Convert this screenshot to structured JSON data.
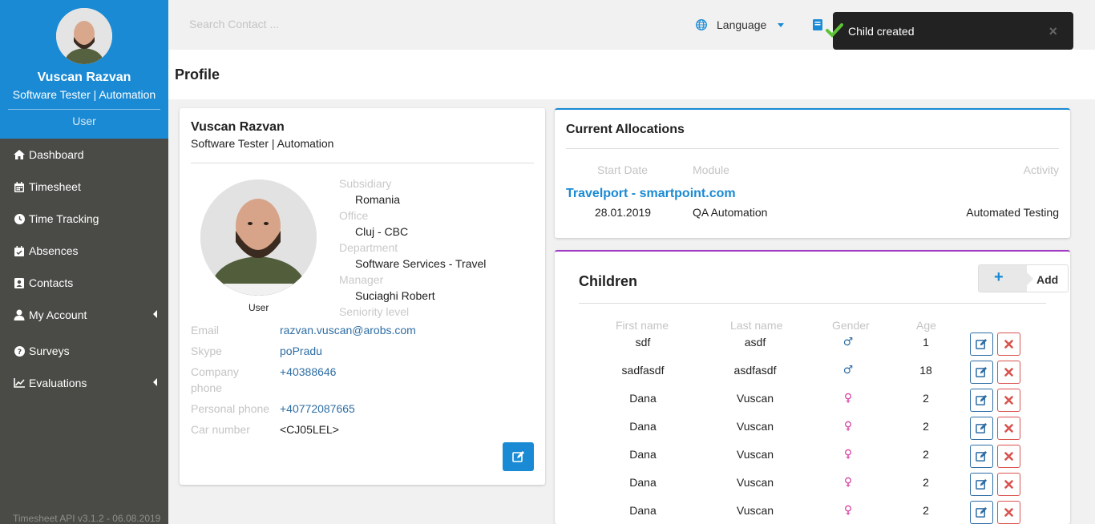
{
  "sidebar": {
    "user_name": "Vuscan Razvan",
    "user_role": "Software Tester | Automation",
    "user_type": "User",
    "items": [
      {
        "label": "Dashboard",
        "icon": "home-icon"
      },
      {
        "label": "Timesheet",
        "icon": "calendar-icon"
      },
      {
        "label": "Time Tracking",
        "icon": "clock-icon"
      },
      {
        "label": "Absences",
        "icon": "calendar-check-icon"
      },
      {
        "label": "Contacts",
        "icon": "contact-card-icon"
      },
      {
        "label": "My Account",
        "icon": "user-icon"
      },
      {
        "label": "Surveys",
        "icon": "question-circle-icon"
      },
      {
        "label": "Evaluations",
        "icon": "line-chart-icon"
      }
    ],
    "footer": "Timesheet API v3.1.2 - 06.08.2019"
  },
  "topbar": {
    "search_placeholder": "Search Contact ...",
    "language_label": "Language"
  },
  "toast": {
    "message": "Child created",
    "close": "×"
  },
  "page": {
    "title": "Profile"
  },
  "profile": {
    "name": "Vuscan Razvan",
    "role": "Software Tester | Automation",
    "avatar_label": "User",
    "org": {
      "subsidiary_label": "Subsidiary",
      "subsidiary": "Romania",
      "office_label": "Office",
      "office": "Cluj - CBC",
      "department_label": "Department",
      "department": "Software Services - Travel",
      "manager_label": "Manager",
      "manager": "Suciaghi Robert",
      "seniority_label": "Seniority level"
    },
    "contact": {
      "email_label": "Email",
      "email": "razvan.vuscan@arobs.com",
      "skype_label": "Skype",
      "skype": "poPradu",
      "company_phone_label_1": "Company",
      "company_phone_label_2": "phone",
      "company_phone": "+40388646",
      "personal_phone_label": "Personal phone",
      "personal_phone": "+40772087665",
      "car_label": "Car number",
      "car": "<CJ05LEL>"
    }
  },
  "allocations": {
    "title": "Current Allocations",
    "headers": {
      "start_date": "Start Date",
      "module": "Module",
      "activity": "Activity"
    },
    "project": "Travelport - smartpoint.com",
    "start_date": "28.01.2019",
    "module": "QA Automation",
    "activity": "Automated Testing"
  },
  "children": {
    "title": "Children",
    "add_label": "Add",
    "add_icon": "+",
    "headers": {
      "first_name": "First name",
      "last_name": "Last name",
      "gender": "Gender",
      "age": "Age"
    },
    "rows": [
      {
        "first": "sdf",
        "last": "asdf",
        "gender": "♂",
        "age": "1"
      },
      {
        "first": "sadfasdf",
        "last": "asdfasdf",
        "gender": "♂",
        "age": "18"
      },
      {
        "first": "Dana",
        "last": "Vuscan",
        "gender": "♀",
        "age": "2"
      },
      {
        "first": "Dana",
        "last": "Vuscan",
        "gender": "♀",
        "age": "2"
      },
      {
        "first": "Dana",
        "last": "Vuscan",
        "gender": "♀",
        "age": "2"
      },
      {
        "first": "Dana",
        "last": "Vuscan",
        "gender": "♀",
        "age": "2"
      },
      {
        "first": "Dana",
        "last": "Vuscan",
        "gender": "♀",
        "age": "2"
      }
    ],
    "colors": {
      "male": "#2e6da4",
      "female": "#d6379f"
    }
  }
}
